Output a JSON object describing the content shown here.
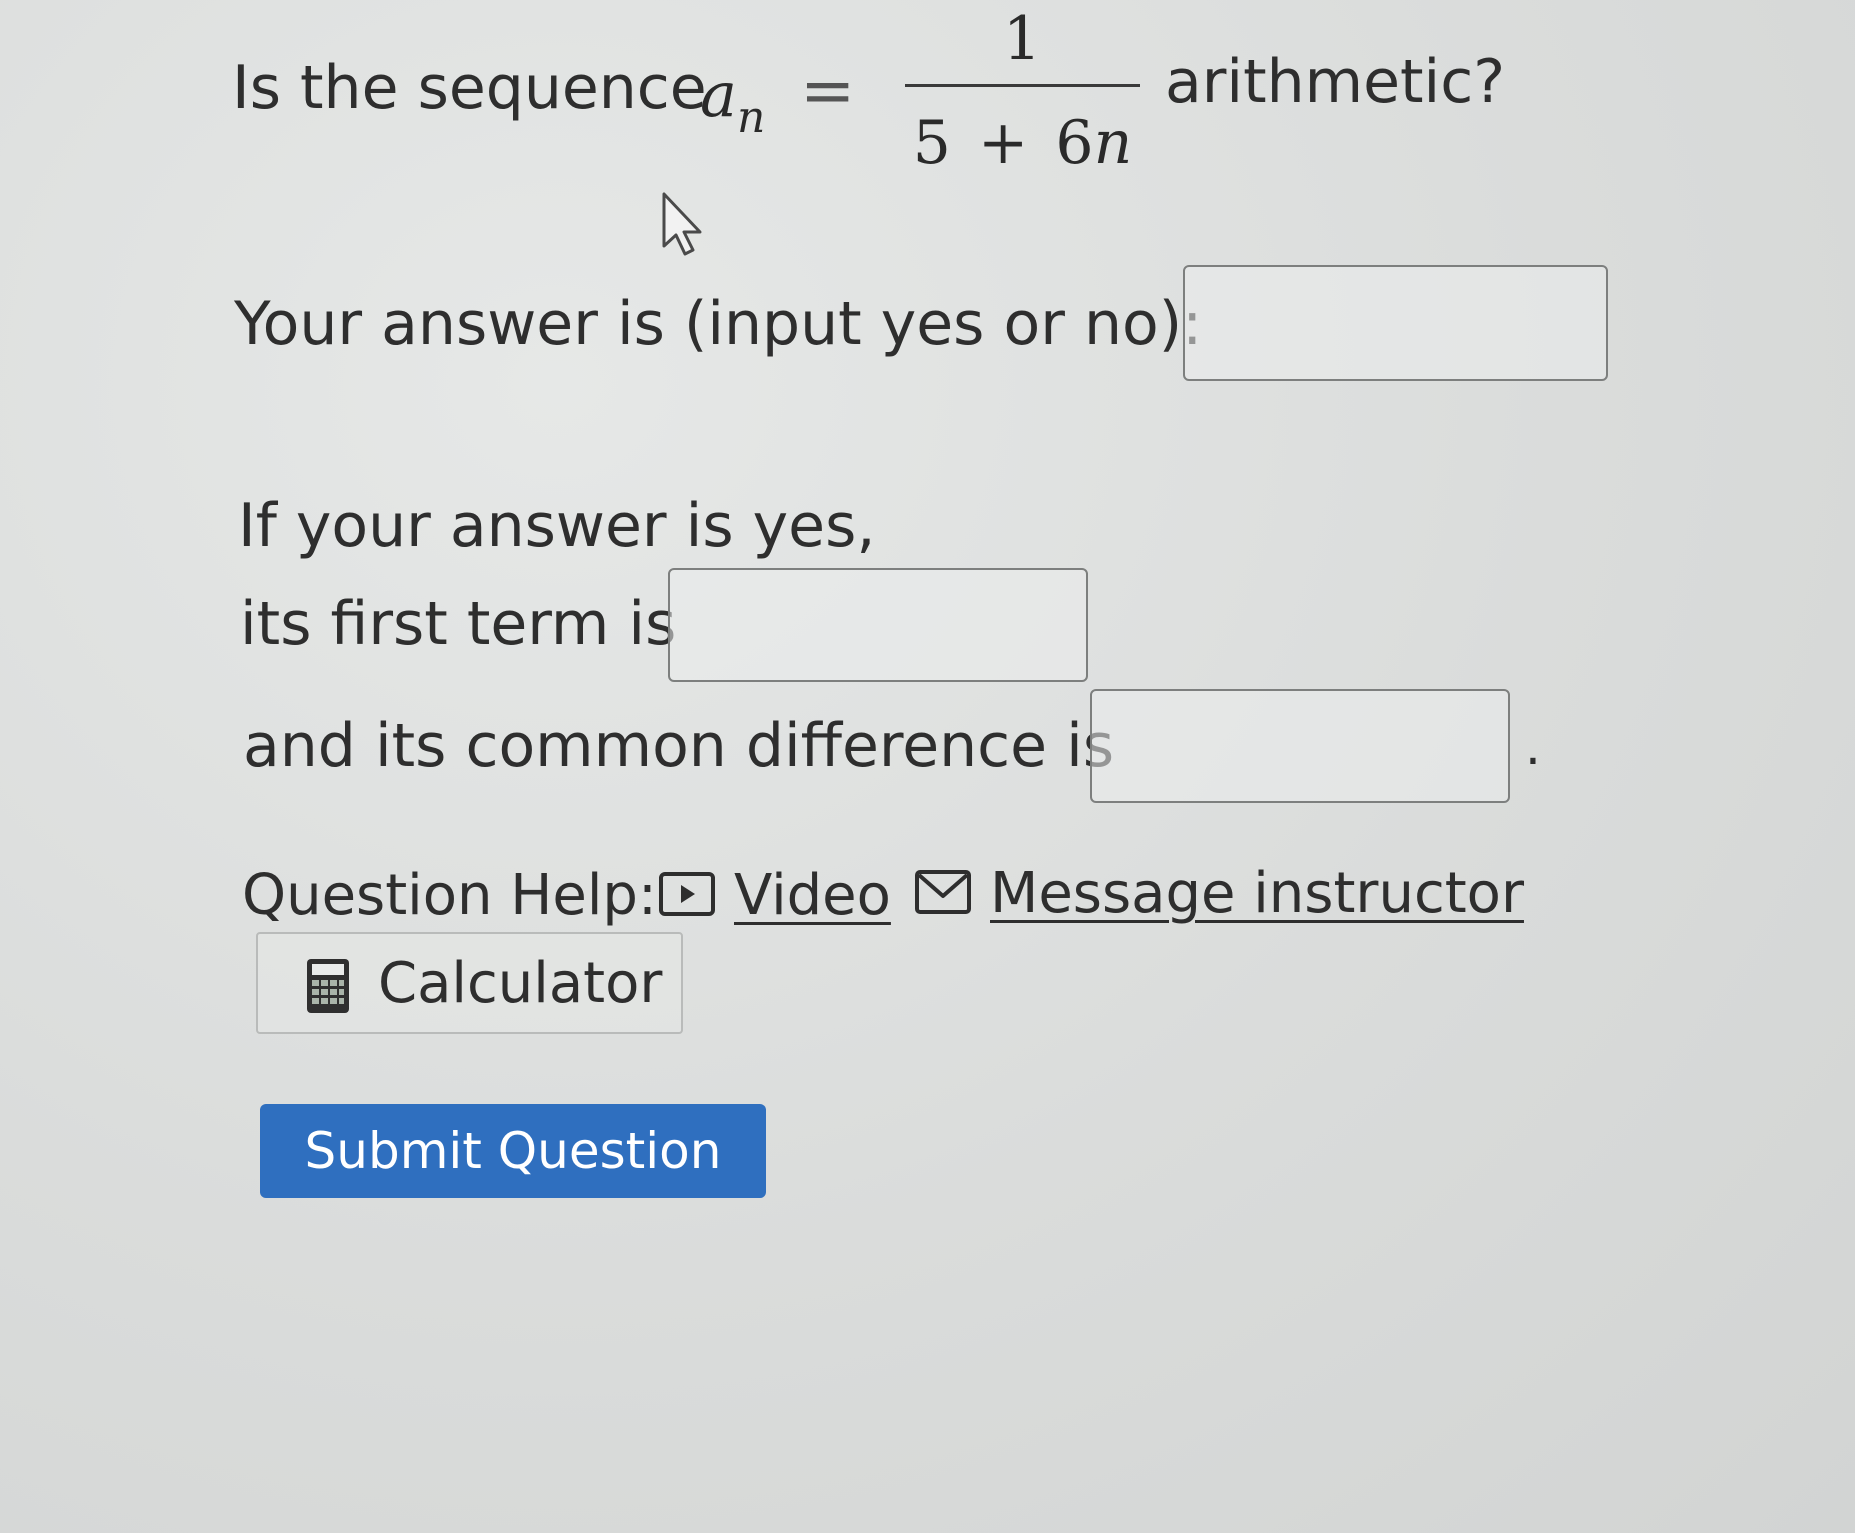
{
  "question": {
    "prefix": "Is the sequence",
    "var_base": "a",
    "var_sub": "n",
    "equals": "=",
    "numerator": "1",
    "den_left": "5",
    "den_op": "+",
    "den_coef": "6",
    "den_var": "n",
    "suffix": "arithmetic?"
  },
  "answer": {
    "label": "Your answer is (input yes or no):",
    "value": ""
  },
  "followup": {
    "line1": "If your answer is yes,",
    "first_term_label": "its first term is",
    "first_term_value": "",
    "difference_label": "and its common difference is",
    "difference_value": "",
    "trailing_period": "."
  },
  "help": {
    "label": "Question Help:",
    "video_label": "Video",
    "message_label": "Message instructor",
    "calculator_label": "Calculator"
  },
  "submit": {
    "label": "Submit Question"
  },
  "colors": {
    "submit_bg": "#2f6fbf",
    "page_bg": "#dcdedd"
  }
}
